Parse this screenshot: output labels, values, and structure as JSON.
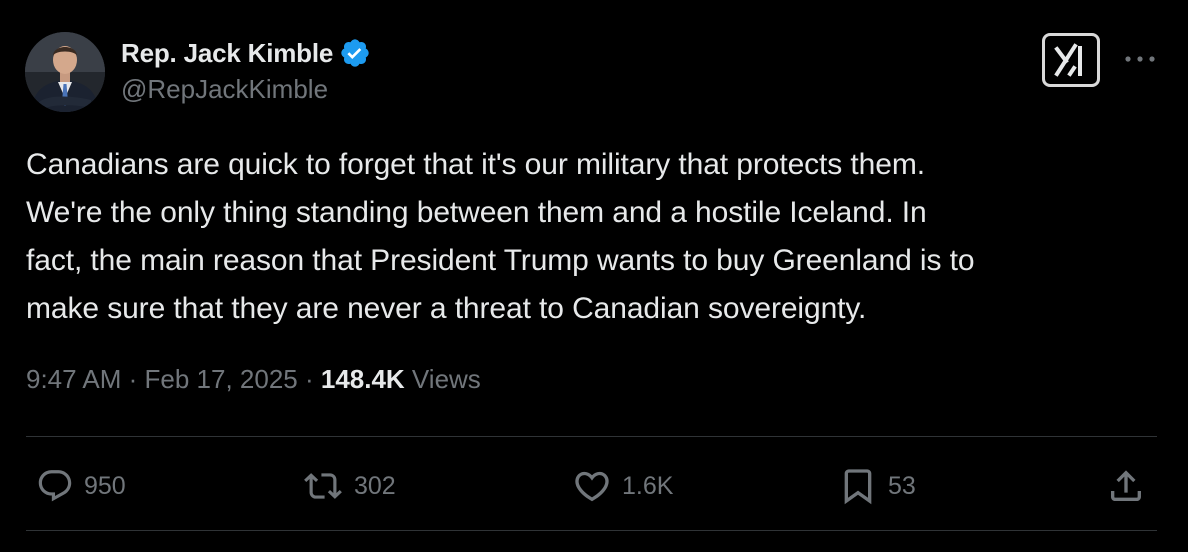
{
  "author": {
    "display_name": "Rep. Jack Kimble",
    "handle": "@RepJackKimble",
    "verified": true,
    "verified_color": "#1d9bf0"
  },
  "header_actions": {
    "grok_icon": "grok-logo-icon",
    "more_icon": "more-options-icon"
  },
  "tweet": {
    "text": "Canadians are quick to forget that it's our military that protects them.\nWe're the only thing standing between them and a hostile Iceland.  In\nfact, the main reason that President Trump wants to buy Greenland is to\nmake sure that they are never a threat to Canadian sovereignty."
  },
  "meta": {
    "time": "9:47 AM",
    "separator": " · ",
    "date": "Feb 17, 2025",
    "separator2": " · ",
    "views_count": "148.4K",
    "views_label": " Views"
  },
  "actions": {
    "reply_count": "950",
    "repost_count": "302",
    "like_count": "1.6K",
    "bookmark_count": "53"
  },
  "colors": {
    "background": "#000000",
    "text_primary": "#e7e9ea",
    "text_secondary": "#71767b",
    "divider": "#2f3336",
    "accent": "#1d9bf0"
  }
}
